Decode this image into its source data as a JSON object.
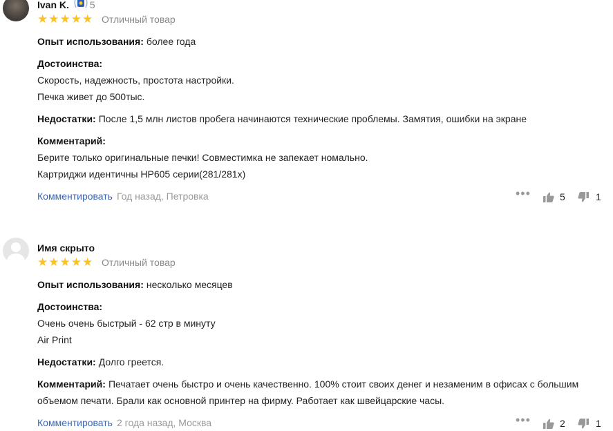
{
  "reviews": [
    {
      "author": "Ivan K.",
      "badge_count": "5",
      "stars": "★★★★★",
      "verdict": "Отличный товар",
      "experience_label": "Опыт использования:",
      "experience_value": "более года",
      "pros_label": "Достоинства:",
      "pros_lines": [
        "Скорость, надежность, простота настройки.",
        "Печка живет до 500тыс."
      ],
      "cons_label": "Недостатки:",
      "cons_value": "После 1,5 млн листов пробега начинаются технические проблемы. Замятия, ошибки на экране",
      "comment_label": "Комментарий:",
      "comment_lines": [
        "Берите только оригинальные печки! Совместимка не запекает номально.",
        "Картриджи идентичны HP605 серии(281/281х)"
      ],
      "comment_link": "Комментировать",
      "meta": "Год назад, Петровка",
      "likes": "5",
      "dislikes": "1"
    },
    {
      "author": "Имя скрыто",
      "stars": "★★★★★",
      "verdict": "Отличный товар",
      "experience_label": "Опыт использования:",
      "experience_value": "несколько месяцев",
      "pros_label": "Достоинства:",
      "pros_lines": [
        "Очень очень быстрый - 62 стр в минуту",
        "Air Print"
      ],
      "cons_label": "Недостатки:",
      "cons_value": "Долго греется.",
      "comment_label": "Комментарий:",
      "comment_lines": [
        "Печатает очень быстро и очень качественно. 100% стоит своих денег и незаменим в офисах с большим",
        "объемом печати. Брали как основной принтер на фирму. Работает как швейцарские часы."
      ],
      "comment_link": "Комментировать",
      "meta": "2 года назад, Москва",
      "likes": "2",
      "dislikes": "1"
    }
  ],
  "colors": {
    "star": "#fdc21f",
    "link": "#3b66b3",
    "muted": "#888888"
  },
  "icons": [
    "user-avatar",
    "achievement-badge-icon",
    "more-dots-icon",
    "thumbs-up-icon",
    "thumbs-down-icon"
  ]
}
